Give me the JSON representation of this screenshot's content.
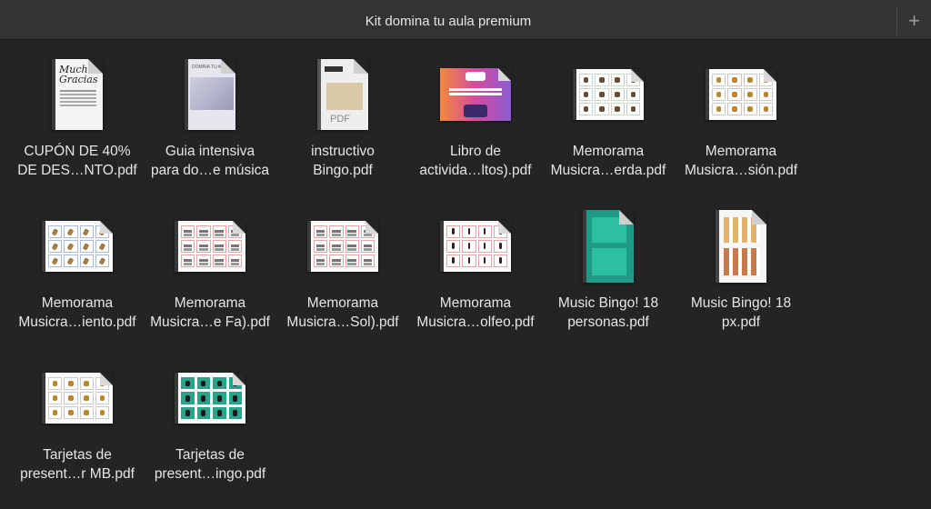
{
  "window": {
    "title": "Kit domina tu aula premium",
    "add_tab_label": "+"
  },
  "files": [
    {
      "line1": "CUPÓN DE 40%",
      "line2": "DE DES…NTO.pdf",
      "thumb": "coupon",
      "thumb_text": "Muchas Gracias"
    },
    {
      "line1": "Guia intensiva",
      "line2": "para do…e música",
      "thumb": "guide",
      "thumb_text": "DOMINA TU AULA"
    },
    {
      "line1": "instructivo",
      "line2": "Bingo.pdf",
      "thumb": "instructivo",
      "thumb_text": "PDF"
    },
    {
      "line1": "Libro de",
      "line2": "activida…ltos).pdf",
      "thumb": "libro",
      "thumb_text": ""
    },
    {
      "line1": "Memorama",
      "line2": "Musicra…erda.pdf",
      "thumb": "memo-green",
      "thumb_text": ""
    },
    {
      "line1": "Memorama",
      "line2": "Musicra…sión.pdf",
      "thumb": "memo-perc",
      "thumb_text": ""
    },
    {
      "line1": "Memorama",
      "line2": "Musicra…iento.pdf",
      "thumb": "memo-blue",
      "thumb_text": ""
    },
    {
      "line1": "Memorama",
      "line2": "Musicra…e Fa).pdf",
      "thumb": "memo-red",
      "thumb_text": ""
    },
    {
      "line1": "Memorama",
      "line2": "Musicra…Sol).pdf",
      "thumb": "memo-red",
      "thumb_text": ""
    },
    {
      "line1": "Memorama",
      "line2": "Musicra…olfeo.pdf",
      "thumb": "memo-notes",
      "thumb_text": ""
    },
    {
      "line1": "Music Bingo! 18",
      "line2": "personas.pdf",
      "thumb": "bingo-green",
      "thumb_text": ""
    },
    {
      "line1": "Music Bingo! 18",
      "line2": "px.pdf",
      "thumb": "bingo-white",
      "thumb_text": ""
    },
    {
      "line1": "Tarjetas de",
      "line2": "present…r MB.pdf",
      "thumb": "tarjetas-white",
      "thumb_text": ""
    },
    {
      "line1": "Tarjetas de",
      "line2": "present…ingo.pdf",
      "thumb": "tarjetas-green",
      "thumb_text": ""
    }
  ]
}
